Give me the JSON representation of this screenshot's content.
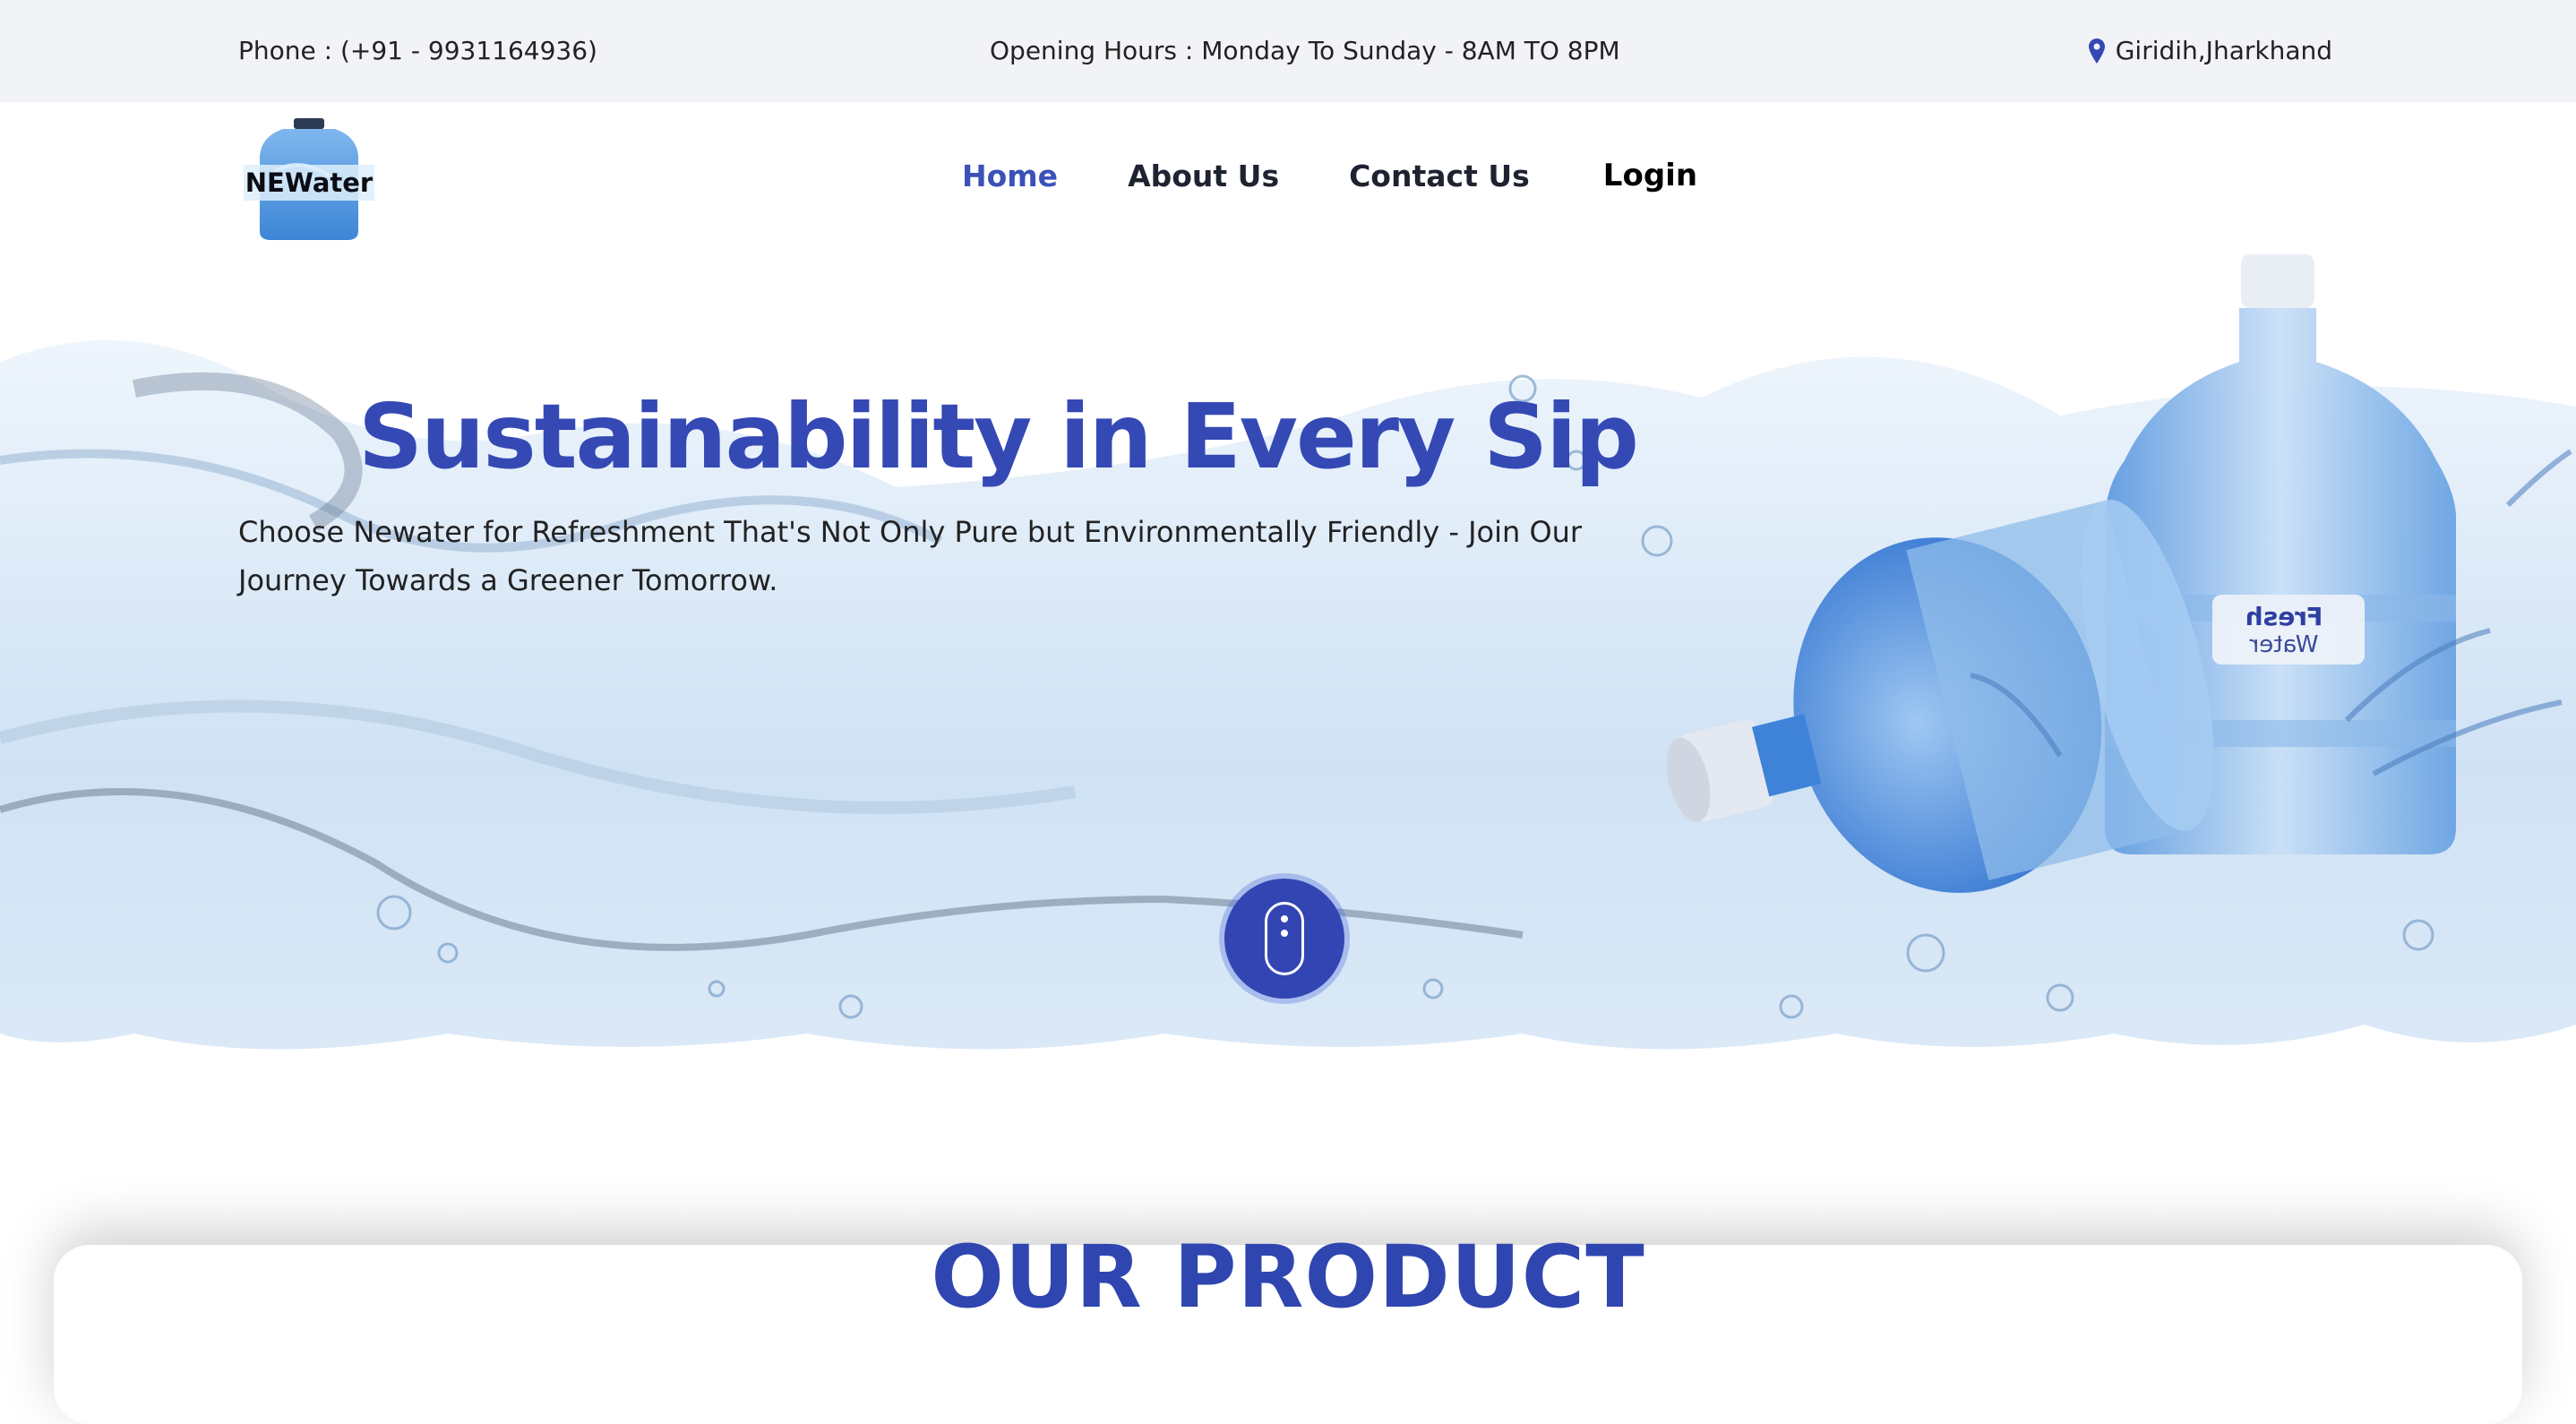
{
  "topbar": {
    "phone": "Phone : (+91 - 9931164936)",
    "hours": "Opening Hours : Monday To Sunday - 8AM TO 8PM",
    "location": "Giridih,Jharkhand",
    "location_icon": "map-pin-icon"
  },
  "header": {
    "logo_text": "NEWater",
    "nav": {
      "home": "Home",
      "about": "About Us",
      "contact": "Contact Us",
      "login": "Login"
    }
  },
  "hero": {
    "title": "Sustainability in Every Sip",
    "subtitle": "Choose Newater for Refreshment That's Not Only Pure but Environmentally Friendly - Join Our Journey Towards a Greener Tomorrow.",
    "bottle_label_line1": "Fresh",
    "bottle_label_line2": "Water",
    "scroll_icon": "mouse-scroll-icon"
  },
  "products": {
    "heading": "OUR PRODUCT"
  },
  "colors": {
    "brand_blue": "#3549b5",
    "topbar_bg": "#f2f3f7",
    "text_dark": "#1f2230"
  }
}
